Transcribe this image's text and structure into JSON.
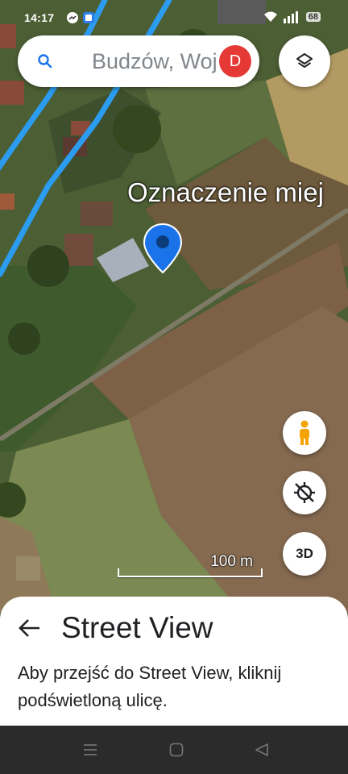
{
  "status_bar": {
    "time": "14:17",
    "battery": "68"
  },
  "search": {
    "placeholder": "Budzów, Woj",
    "avatar_letter": "D"
  },
  "map": {
    "place_label": "Oznaczenie miej",
    "scale_label": "100 m",
    "button_3d": "3D"
  },
  "street_view": {
    "title": "Street View",
    "description": "Aby przejść do Street View, kliknij podświetloną ulicę."
  },
  "colors": {
    "pin": "#1a73e8",
    "road_highlight": "#2b9cf0",
    "avatar": "#e53935"
  },
  "icons": [
    "search-icon",
    "layers-icon",
    "pegman-icon",
    "compass-icon",
    "back-arrow-icon",
    "nav-menu-icon",
    "nav-home-icon",
    "nav-back-icon"
  ]
}
